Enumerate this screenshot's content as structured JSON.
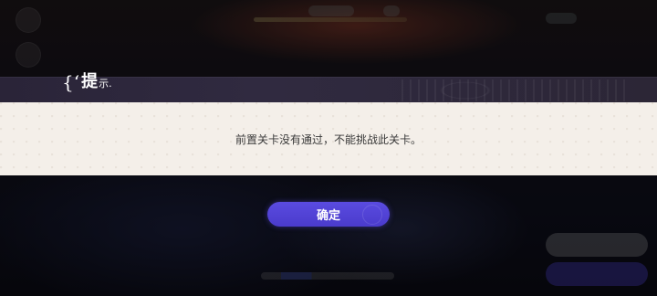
{
  "dialog": {
    "title_brace": "{‘",
    "title_main": "提",
    "title_small": "示.",
    "message": "前置关卡没有通过，不能挑战此关卡。",
    "confirm_label": "确定"
  },
  "colors": {
    "accent": "#5a4be0",
    "panel": "#f4efe9",
    "header": "#2e2840"
  }
}
